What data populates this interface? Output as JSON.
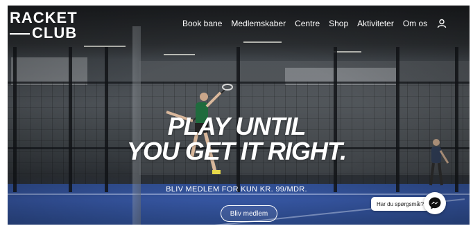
{
  "header": {
    "logo_line1": "RACKET",
    "logo_line2": "CLUB",
    "nav": [
      {
        "label": "Book bane"
      },
      {
        "label": "Medlemskaber"
      },
      {
        "label": "Centre"
      },
      {
        "label": "Shop"
      },
      {
        "label": "Aktiviteter"
      },
      {
        "label": "Om os"
      }
    ],
    "user_icon": "user-icon"
  },
  "hero": {
    "headline_line1": "PLAY UNTIL",
    "headline_line2": "YOU GET IT RIGHT.",
    "subline": "BLIV MEDLEM FOR KUN KR. 99/MDR.",
    "cta_label": "Bliv medlem",
    "background": "padel court with player",
    "court_color": "#3656a2"
  },
  "chat": {
    "prompt": "Har du spørgsmål?",
    "icon": "messenger-icon"
  }
}
